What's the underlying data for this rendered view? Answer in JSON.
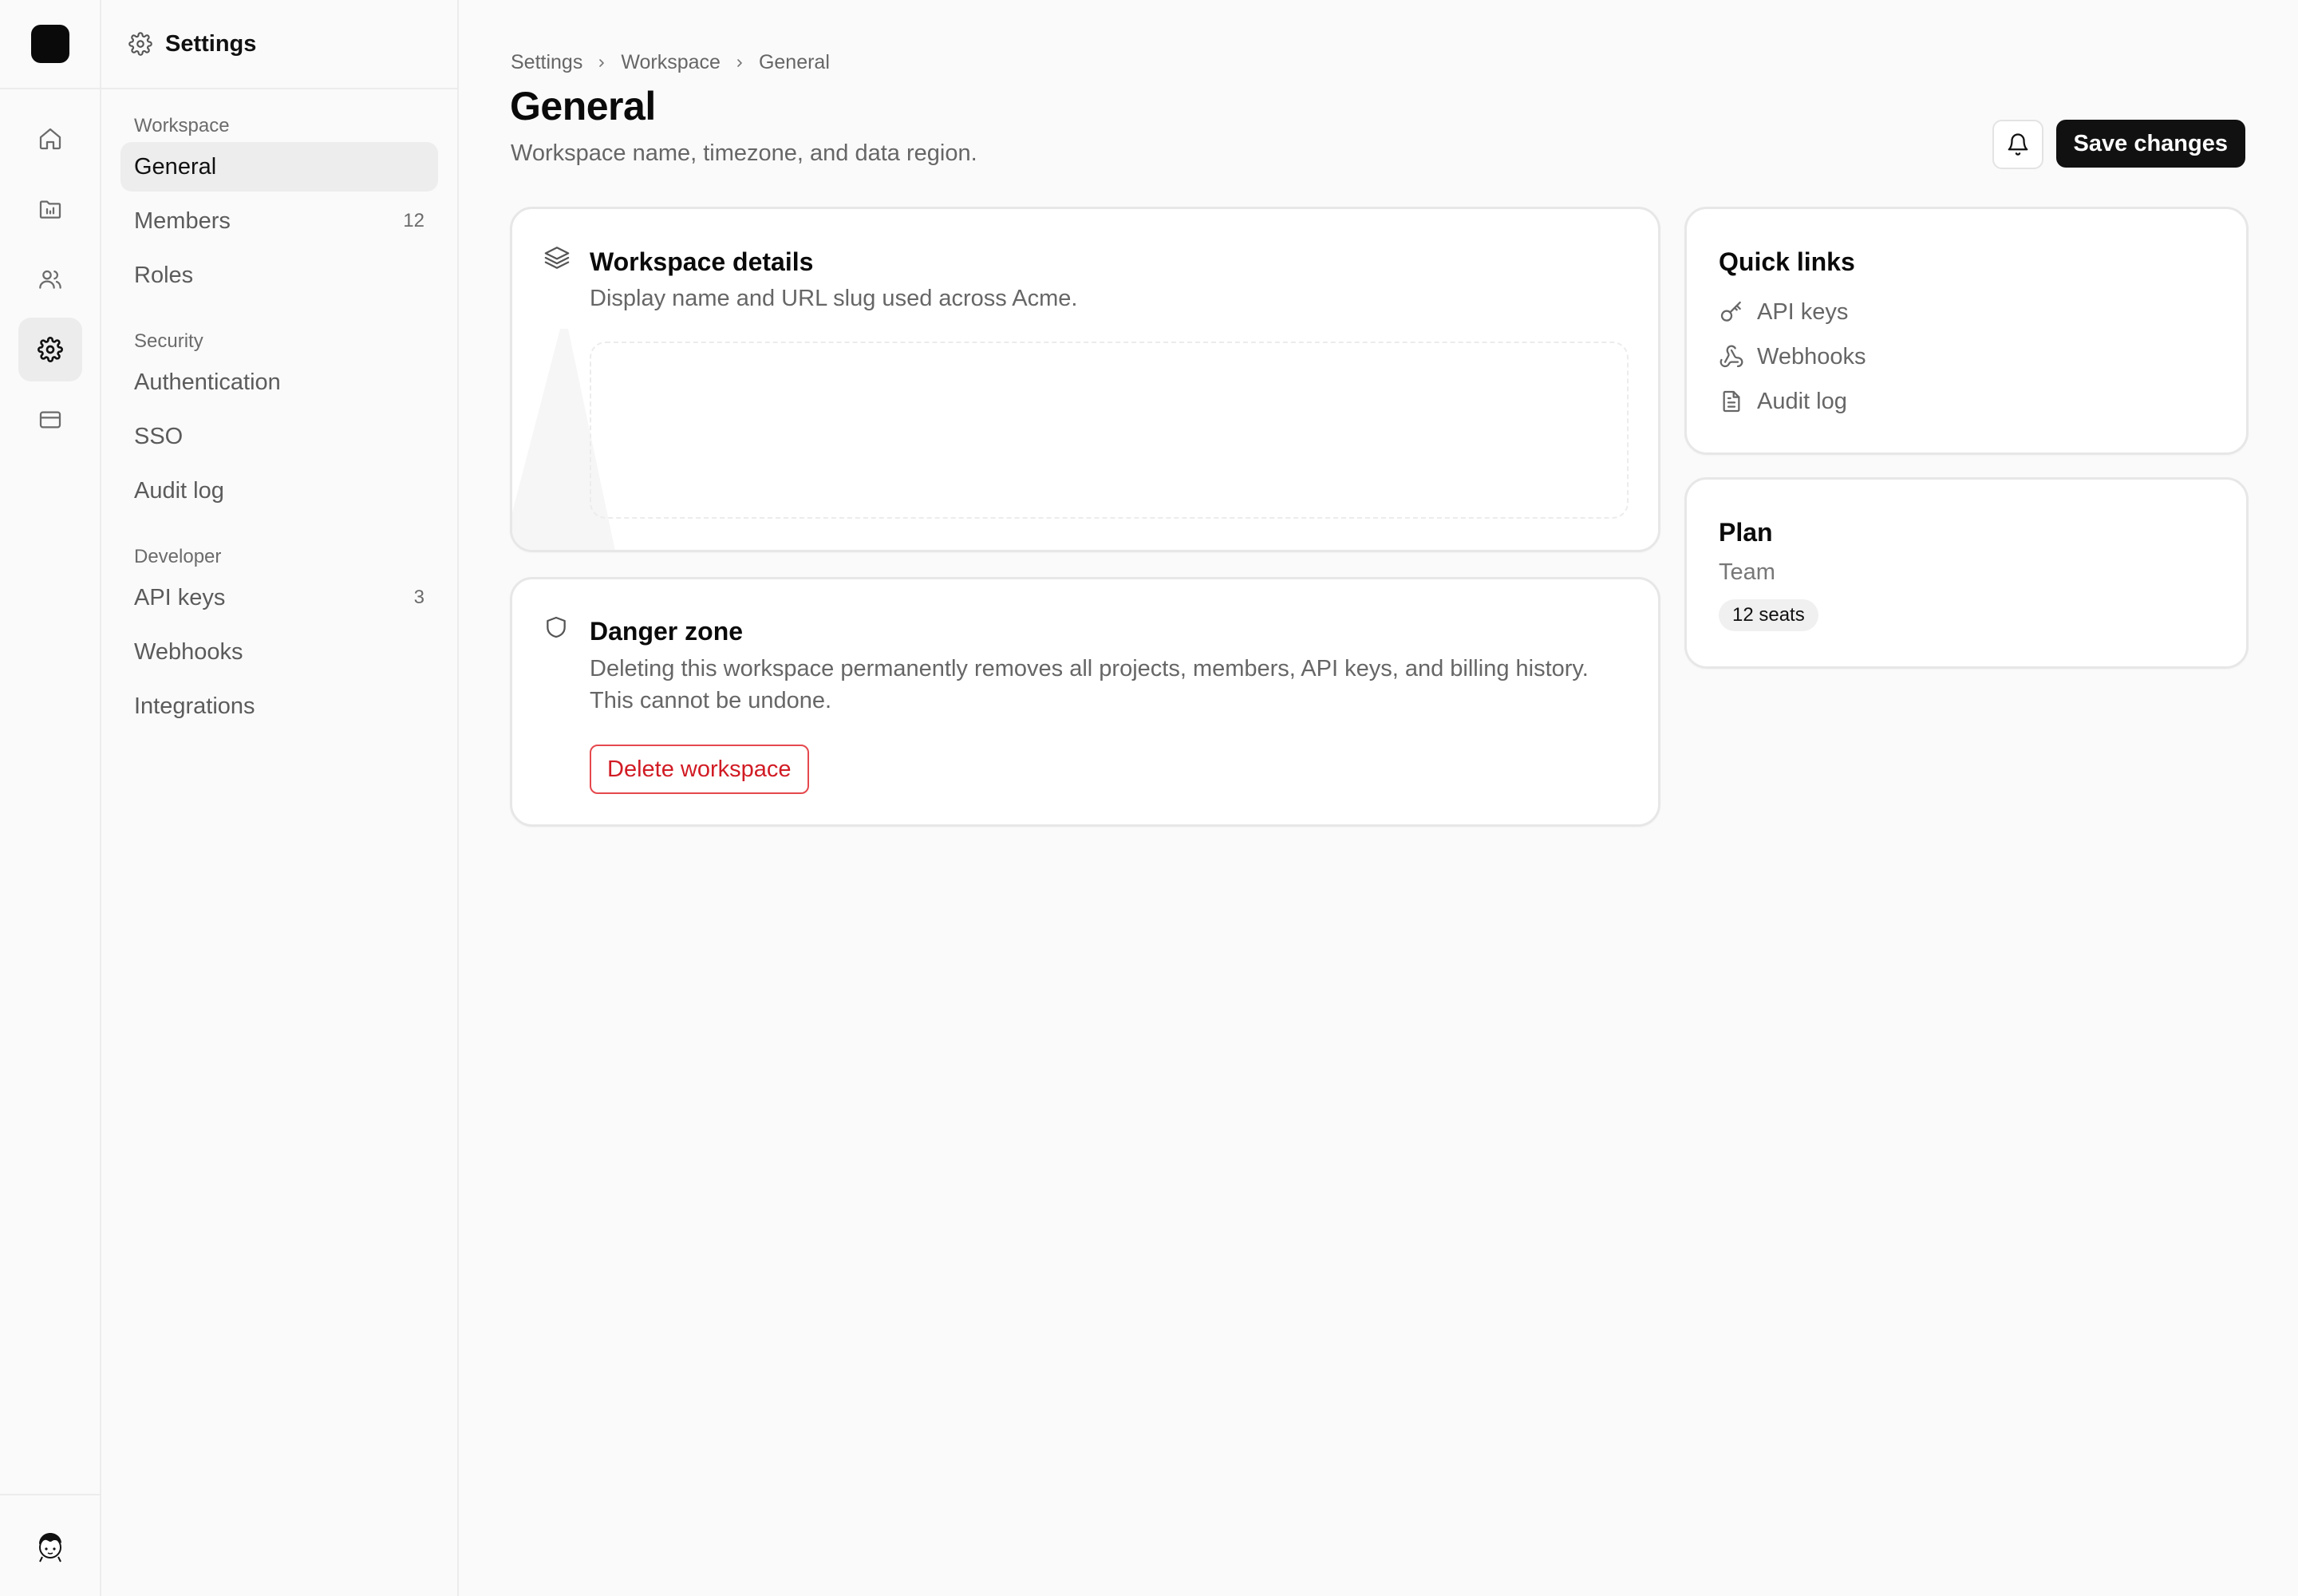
{
  "rail": {
    "items": [
      {
        "icon": "home-icon"
      },
      {
        "icon": "folder-icon"
      },
      {
        "icon": "users-icon"
      },
      {
        "icon": "settings-icon",
        "active": true
      },
      {
        "icon": "card-icon"
      }
    ]
  },
  "sidebar": {
    "title": "Settings",
    "groups": [
      {
        "label": "Workspace",
        "items": [
          {
            "label": "General",
            "active": true
          },
          {
            "label": "Members",
            "count": "12"
          },
          {
            "label": "Roles"
          }
        ]
      },
      {
        "label": "Security",
        "items": [
          {
            "label": "Authentication"
          },
          {
            "label": "SSO"
          },
          {
            "label": "Audit log"
          }
        ]
      },
      {
        "label": "Developer",
        "items": [
          {
            "label": "API keys",
            "count": "3"
          },
          {
            "label": "Webhooks"
          },
          {
            "label": "Integrations"
          }
        ]
      }
    ]
  },
  "header": {
    "breadcrumb": [
      "Settings",
      "Workspace",
      "General"
    ],
    "title": "General",
    "subtitle": "Workspace name, timezone, and data region.",
    "save_label": "Save changes"
  },
  "details_card": {
    "title": "Workspace details",
    "description": "Display name and URL slug used across Acme."
  },
  "danger_card": {
    "title": "Danger zone",
    "description_line1": "Deleting this workspace permanently removes all projects, members, API keys, and billing history.",
    "description_line2": "This cannot be undone.",
    "button_label": "Delete workspace"
  },
  "quick_links": {
    "title": "Quick links",
    "items": [
      {
        "label": "API keys",
        "icon": "key-icon"
      },
      {
        "label": "Webhooks",
        "icon": "webhook-icon"
      },
      {
        "label": "Audit log",
        "icon": "document-icon"
      }
    ]
  },
  "plan": {
    "title": "Plan",
    "name": "Team",
    "seats": "12 seats"
  },
  "colors": {
    "accent_dark": "#111111",
    "danger": "#d11b24",
    "background": "#fafafa"
  }
}
